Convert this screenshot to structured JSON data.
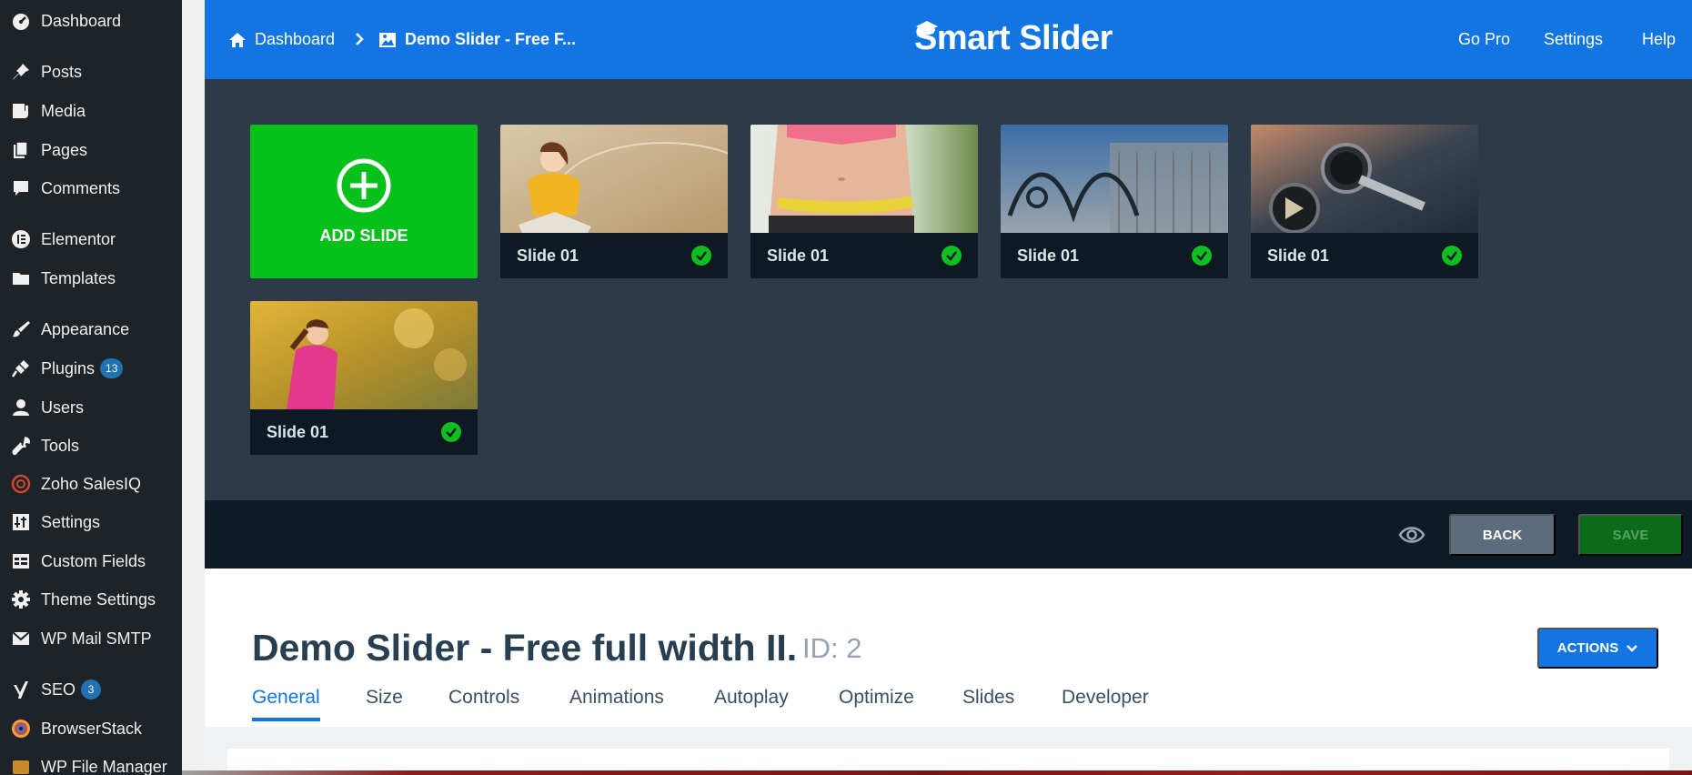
{
  "sidebar": {
    "items": [
      {
        "label": "Dashboard",
        "icon": "dashboard-icon"
      },
      {
        "label": "Posts",
        "icon": "pin-icon"
      },
      {
        "label": "Media",
        "icon": "media-icon"
      },
      {
        "label": "Pages",
        "icon": "pages-icon"
      },
      {
        "label": "Comments",
        "icon": "comment-icon"
      },
      {
        "label": "Elementor",
        "icon": "elementor-icon"
      },
      {
        "label": "Templates",
        "icon": "folder-icon"
      },
      {
        "label": "Appearance",
        "icon": "paintbrush-icon"
      },
      {
        "label": "Plugins",
        "icon": "plugin-icon",
        "badge": "13"
      },
      {
        "label": "Users",
        "icon": "user-icon"
      },
      {
        "label": "Tools",
        "icon": "wrench-icon"
      },
      {
        "label": "Zoho SalesIQ",
        "icon": "zoho-icon"
      },
      {
        "label": "Settings",
        "icon": "settings-sliders-icon"
      },
      {
        "label": "Custom Fields",
        "icon": "table-icon"
      },
      {
        "label": "Theme Settings",
        "icon": "gear-icon"
      },
      {
        "label": "WP Mail SMTP",
        "icon": "mail-icon"
      },
      {
        "label": "SEO",
        "icon": "yoast-icon",
        "badge": "3"
      },
      {
        "label": "BrowserStack",
        "icon": "browserstack-icon"
      },
      {
        "label": "WP File Manager",
        "icon": "file-manager-icon"
      }
    ]
  },
  "topbar": {
    "breadcrumb_dashboard": "Dashboard",
    "breadcrumb_current": "Demo Slider - Free F...",
    "logo_text": "Smart Slider",
    "links": [
      "Go Pro",
      "Settings",
      "Help"
    ]
  },
  "slides": {
    "add_label": "ADD SLIDE",
    "items": [
      {
        "title": "Slide 01",
        "thumb": "girl-yellow-shirt"
      },
      {
        "title": "Slide 01",
        "thumb": "waist-measuring-tape"
      },
      {
        "title": "Slide 01",
        "thumb": "cyclist-blue"
      },
      {
        "title": "Slide 01",
        "thumb": "watch-dark"
      },
      {
        "title": "Slide 01",
        "thumb": "runner-pink"
      }
    ]
  },
  "actionbar": {
    "back_label": "BACK",
    "save_label": "SAVE"
  },
  "settings": {
    "title": "Demo Slider - Free full width II.",
    "id_label": "ID: 2",
    "actions_label": "ACTIONS",
    "tabs": [
      "General",
      "Size",
      "Controls",
      "Animations",
      "Autoplay",
      "Optimize",
      "Slides",
      "Developer"
    ],
    "active_tab": "General"
  },
  "colors": {
    "accent": "#1375e4",
    "add_slide_green": "#07c11b",
    "published_check": "#0fbf1f",
    "slides_bg": "#2d3b48",
    "sidebar_bg": "#1d2327"
  }
}
